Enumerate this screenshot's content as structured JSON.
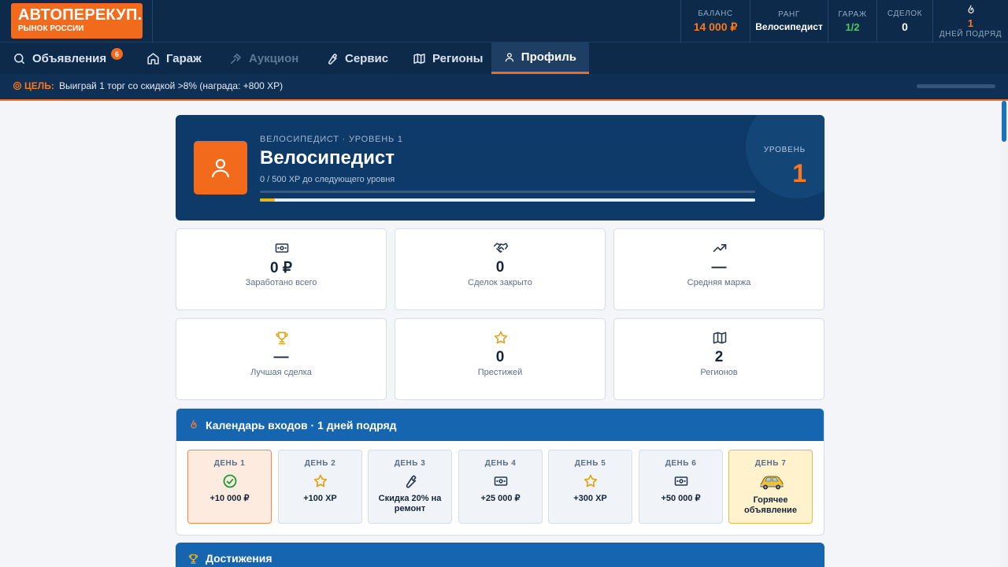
{
  "logo": {
    "title": "АВТОПЕРЕКУП.",
    "subtitle": "РЫНОК РОССИИ"
  },
  "stats": {
    "balance": {
      "label": "БАЛАНС",
      "value": "14 000 ₽"
    },
    "rank": {
      "label": "РАНГ",
      "value": "Велосипедист"
    },
    "garage": {
      "label": "ГАРАЖ",
      "value": "1/2"
    },
    "deals": {
      "label": "СДЕЛОК",
      "value": "0"
    },
    "streak": {
      "value": "1",
      "label": "ДНЕЙ ПОДРЯД",
      "icon": "fire-icon"
    }
  },
  "nav": {
    "tabs": [
      {
        "label": "Объявления",
        "icon": "search-icon",
        "badge": "6"
      },
      {
        "label": "Гараж",
        "icon": "home-icon"
      },
      {
        "label": "Аукцион",
        "icon": "gavel-icon",
        "disabled": true
      },
      {
        "label": "Сервис",
        "icon": "wrench-icon"
      },
      {
        "label": "Регионы",
        "icon": "map-icon"
      },
      {
        "label": "Профиль",
        "icon": "user-icon",
        "active": true
      }
    ]
  },
  "goal": {
    "label": "ЦЕЛЬ:",
    "text": "Выиграй 1 торг со скидкой >8% (награда: +800 XP)"
  },
  "profile": {
    "subtitle": "ВЕЛОСИПЕДИСТ · УРОВЕНЬ 1",
    "title": "Велосипедист",
    "xp_text": "0 / 500 XP до следующего уровня",
    "xp_progress": 0.03,
    "level_label": "УРОВЕНЬ",
    "level": "1"
  },
  "cards": [
    {
      "value": "0 ₽",
      "label": "Заработано всего",
      "icon": "cash-icon"
    },
    {
      "value": "0",
      "label": "Сделок закрыто",
      "icon": "handshake-icon"
    },
    {
      "value": "—",
      "label": "Средняя маржа",
      "icon": "trend-up-icon"
    },
    {
      "value": "—",
      "label": "Лучшая сделка",
      "icon": "trophy-icon"
    },
    {
      "value": "0",
      "label": "Престижей",
      "icon": "star-icon"
    },
    {
      "value": "2",
      "label": "Регионов",
      "icon": "map-icon"
    }
  ],
  "calendar": {
    "title": "Календарь входов · 1 дней подряд",
    "days": [
      {
        "label": "ДЕНЬ 1",
        "reward": "+10 000 ₽",
        "icon": "check-circle-icon"
      },
      {
        "label": "ДЕНЬ 2",
        "reward": "+100 XP",
        "icon": "star-icon"
      },
      {
        "label": "ДЕНЬ 3",
        "reward": "Скидка 20% на ремонт",
        "icon": "wrench-icon"
      },
      {
        "label": "ДЕНЬ 4",
        "reward": "+25 000 ₽",
        "icon": "cash-icon"
      },
      {
        "label": "ДЕНЬ 5",
        "reward": "+300 XP",
        "icon": "star-icon"
      },
      {
        "label": "ДЕНЬ 6",
        "reward": "+50 000 ₽",
        "icon": "cash-icon"
      },
      {
        "label": "ДЕНЬ 7",
        "reward": "Горячее объявление",
        "icon": "car-icon"
      }
    ]
  },
  "achievements": {
    "title": "Достижения"
  },
  "colors": {
    "accent": "#f26b1d",
    "navy": "#0e2a4a",
    "blue": "#1565b1",
    "gold": "#f0b21b",
    "green": "#4cc864"
  }
}
